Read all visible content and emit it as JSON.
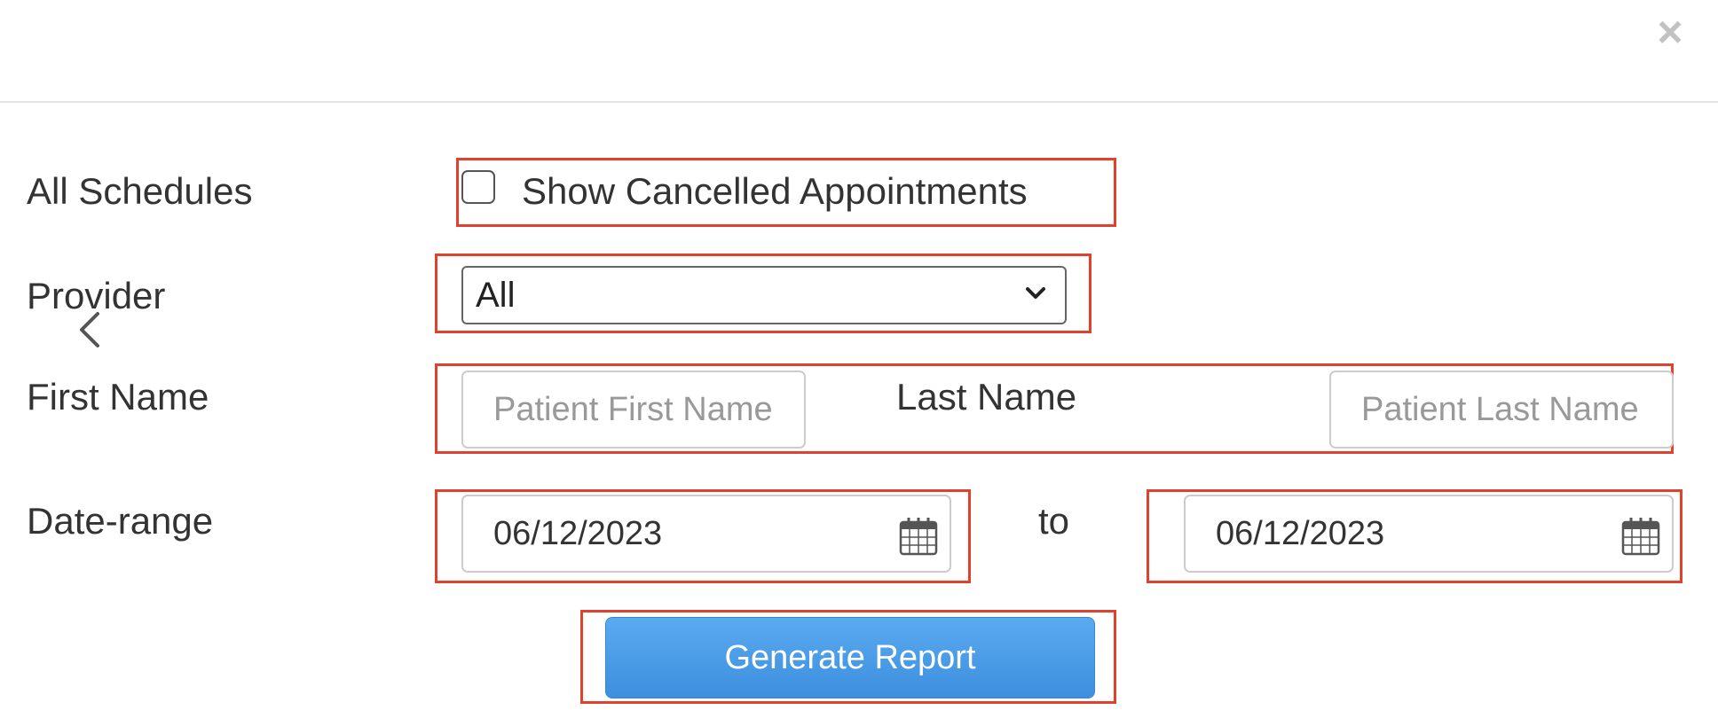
{
  "dialog": {
    "close_label": "×"
  },
  "filters": {
    "schedules_label": "All Schedules",
    "show_cancelled_label": "Show Cancelled Appointments",
    "show_cancelled_checked": false,
    "provider_label": "Provider",
    "provider_selected": "All",
    "first_name_label": "First Name",
    "first_name_placeholder": "Patient First Name",
    "last_name_label": "Last Name",
    "last_name_placeholder": "Patient Last Name",
    "date_range_label": "Date-range",
    "date_from": "06/12/2023",
    "date_to_label": "to",
    "date_to": "06/12/2023"
  },
  "actions": {
    "generate_label": "Generate Report"
  },
  "colors": {
    "highlight": "#e0432d",
    "button": "#4a9be6",
    "close_icon": "#c2c2c2"
  },
  "icons": {
    "close": "close-icon",
    "dropdown": "chevron-down-icon",
    "calendar": "calendar-icon",
    "back": "chevron-left-icon"
  }
}
